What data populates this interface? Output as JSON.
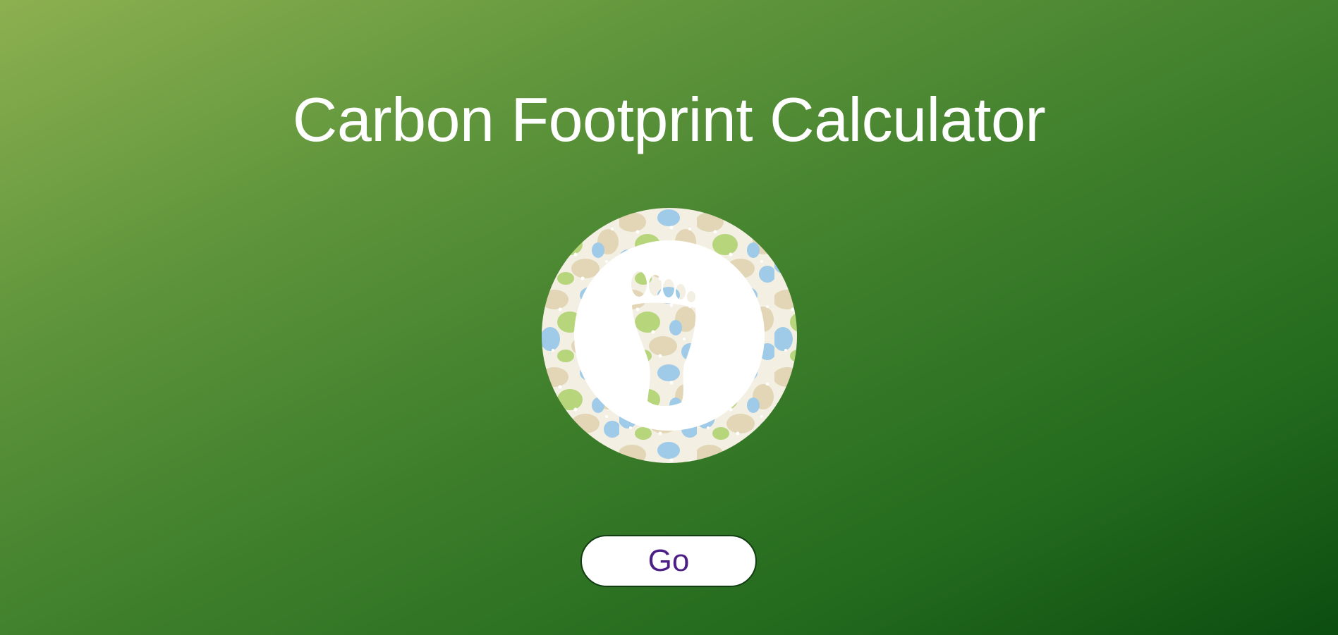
{
  "page": {
    "title": "Carbon Footprint Calculator"
  },
  "logo": {
    "icon": "footprint-icon",
    "colors": {
      "tan": "#e2d6b6",
      "blue": "#9fcbe8",
      "green": "#b7d67c",
      "white": "#ffffff"
    }
  },
  "actions": {
    "go_label": "Go"
  },
  "theme": {
    "gradient_start": "#8cb050",
    "gradient_end": "#0c4d10",
    "button_text": "#4b1f86",
    "button_border": "#123d12"
  }
}
